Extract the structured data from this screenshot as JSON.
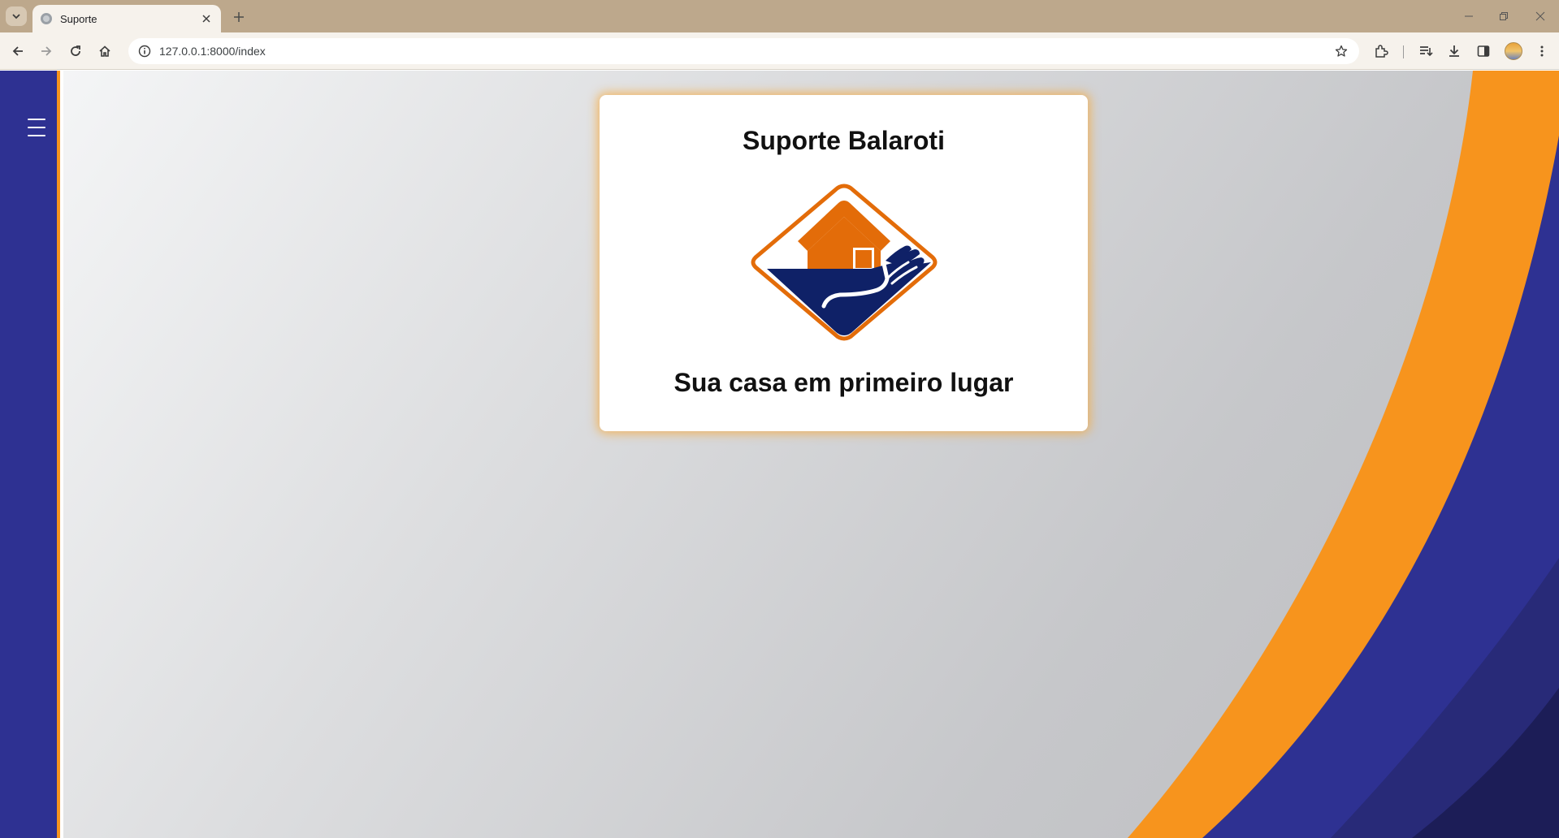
{
  "browser": {
    "tab_title": "Suporte",
    "url": "127.0.0.1:8000/index",
    "icons": [
      "chevron-down-icon",
      "globe-icon",
      "close-icon",
      "plus-icon",
      "minimize-icon",
      "restore-icon",
      "close-window-icon",
      "back-icon",
      "forward-icon",
      "reload-icon",
      "home-icon",
      "info-icon",
      "star-icon",
      "extensions-icon",
      "reading-list-icon",
      "download-icon",
      "side-panel-icon",
      "menu-dots-icon"
    ]
  },
  "sidebar": {
    "menu_icon": "hamburger-menu-icon",
    "color": "#2e3192",
    "border_color": "#f7941d"
  },
  "card": {
    "title": "Suporte Balaroti",
    "tagline": "Sua casa em primeiro lugar",
    "logo_icon": "house-in-hand-logo"
  },
  "colors": {
    "brand_orange": "#f7941d",
    "brand_navy": "#2e3192",
    "logo_orange": "#e36c09",
    "logo_navy": "#0f2167"
  }
}
